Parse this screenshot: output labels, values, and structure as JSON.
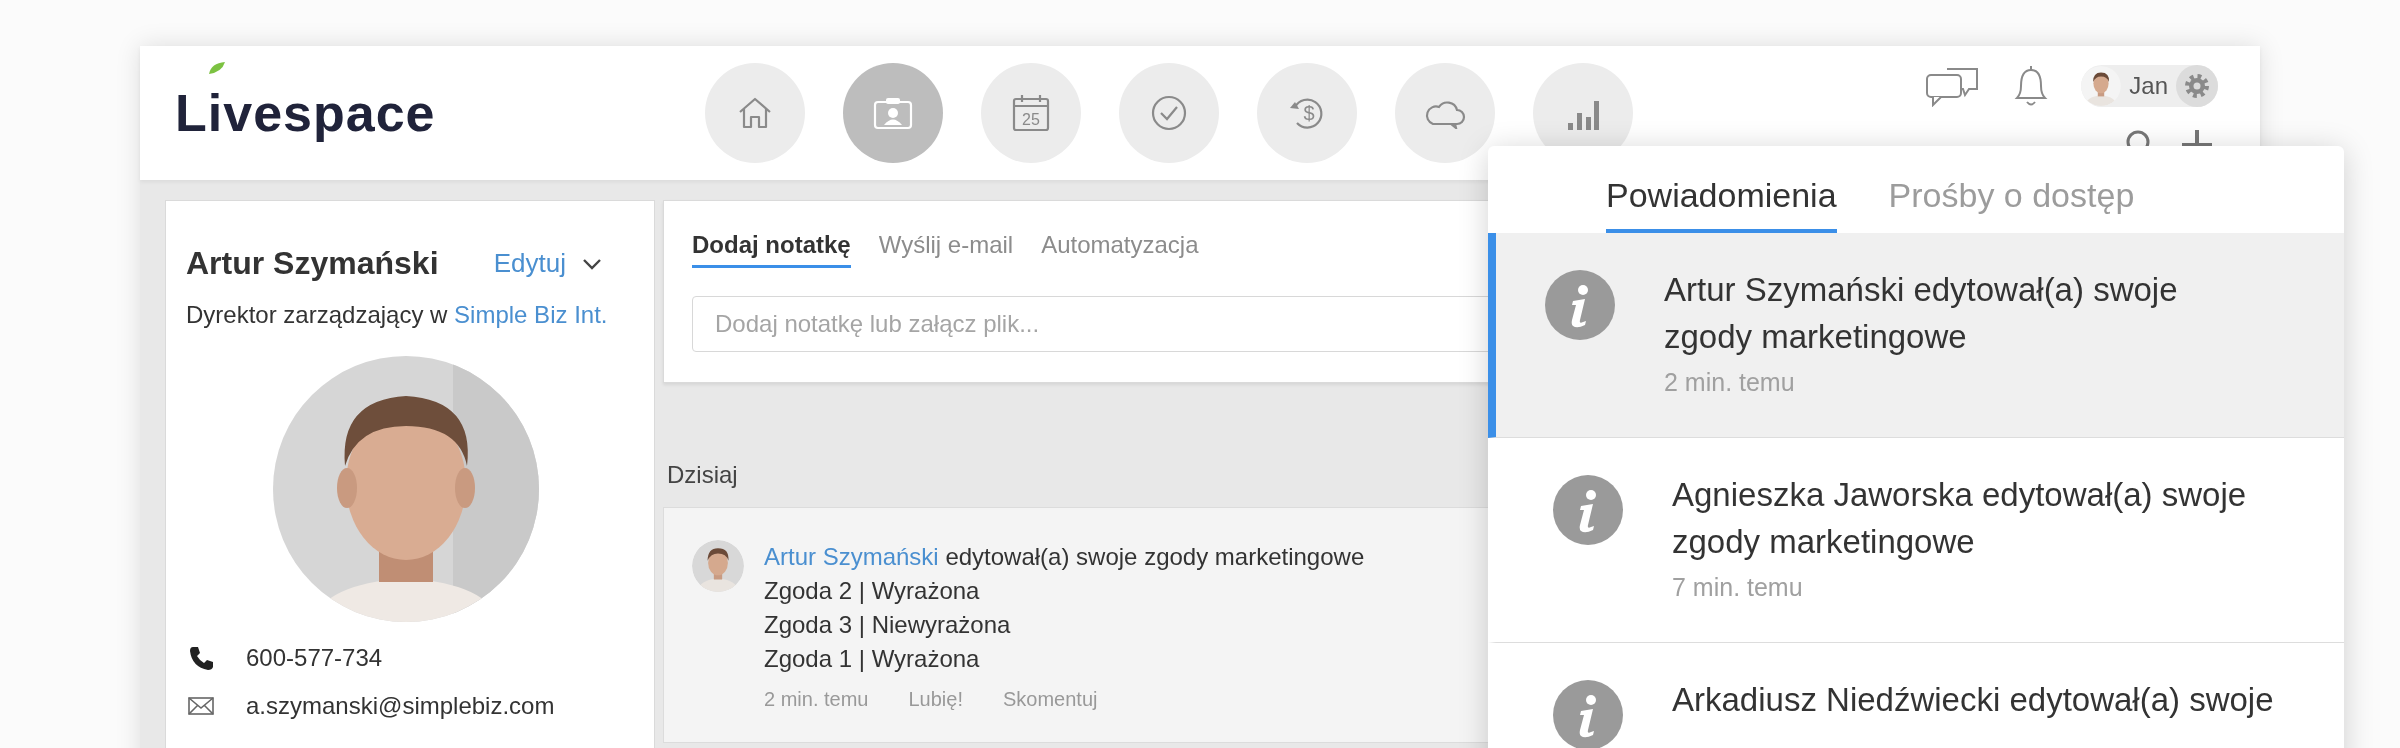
{
  "header": {
    "logo": "Livespace",
    "nav": [
      {
        "kind": "home",
        "selected": false
      },
      {
        "kind": "contacts",
        "selected": true
      },
      {
        "kind": "calendar",
        "label": "25",
        "selected": false
      },
      {
        "kind": "tasks",
        "selected": false
      },
      {
        "kind": "deals",
        "label": "$",
        "selected": false
      },
      {
        "kind": "cloud",
        "selected": false
      },
      {
        "kind": "reports",
        "selected": false
      }
    ],
    "user": {
      "name": "Jan"
    }
  },
  "contact": {
    "name": "Artur Szymański",
    "edit": "Edytuj",
    "title": "Dyrektor zarządzający w",
    "company": "Simple Biz Int.",
    "phone": "600-577-734",
    "email": "a.szymanski@simplebiz.com"
  },
  "composer": {
    "tabs": [
      {
        "label": "Dodaj notatkę",
        "selected": true
      },
      {
        "label": "Wyślij e-mail",
        "selected": false
      },
      {
        "label": "Automatyzacja",
        "selected": false
      }
    ],
    "placeholder": "Dodaj notatkę lub załącz plik..."
  },
  "timeline": {
    "date": "Dzisiaj",
    "entries": [
      {
        "author": "Artur Szymański",
        "text": "edytował(a) swoje zgody marketingowe",
        "lines": [
          "Zgoda 2 | Wyrażona",
          "Zgoda 3 | Niewyrażona",
          "Zgoda 1 | Wyrażona"
        ],
        "time": "2 min. temu",
        "actions": [
          "Lubię!",
          "Skomentuj"
        ]
      }
    ]
  },
  "notifications": {
    "tabs": [
      {
        "label": "Powiadomienia",
        "selected": true
      },
      {
        "label": "Prośby o dostęp",
        "selected": false
      }
    ],
    "items": [
      {
        "text": "Artur Szymański edytował(a) swoje zgody marketingowe",
        "time": "2 min. temu",
        "selected": true
      },
      {
        "text": "Agnieszka Jaworska edytował(a) swoje zgody marketingowe",
        "time": "7 min. temu",
        "selected": false
      },
      {
        "text": "Arkadiusz Niedźwiecki edytował(a) swoje",
        "selected": false
      }
    ]
  }
}
